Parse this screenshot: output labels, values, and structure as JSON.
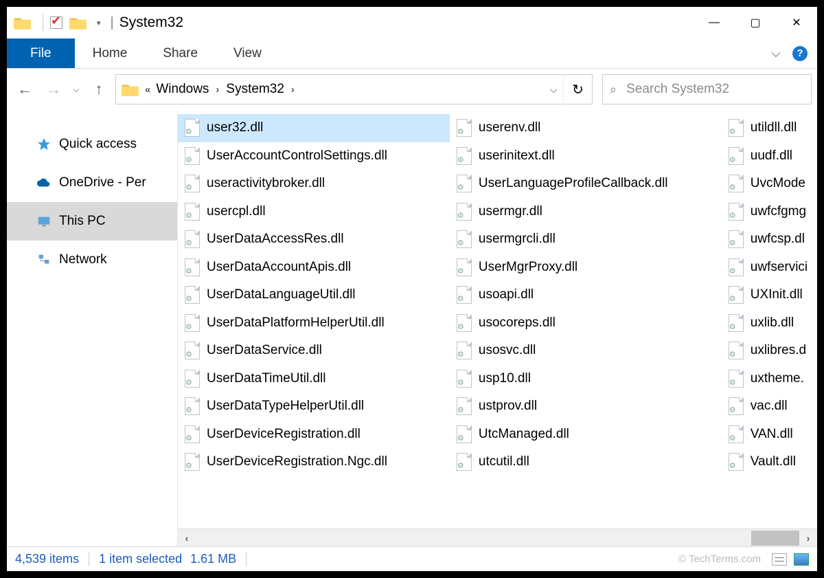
{
  "window": {
    "title": "System32"
  },
  "ribbon": {
    "file": "File",
    "tabs": [
      "Home",
      "Share",
      "View"
    ]
  },
  "nav": {
    "breadcrumbs": [
      "Windows",
      "System32"
    ]
  },
  "search": {
    "placeholder": "Search System32"
  },
  "sidebar": {
    "items": [
      {
        "label": "Quick access",
        "icon": "star",
        "selected": false
      },
      {
        "label": "OneDrive - Per",
        "icon": "cloud",
        "selected": false
      },
      {
        "label": "This PC",
        "icon": "pc",
        "selected": true
      },
      {
        "label": "Network",
        "icon": "network",
        "selected": false
      }
    ]
  },
  "files": {
    "columns": [
      [
        {
          "name": "user32.dll",
          "selected": true
        },
        {
          "name": "UserAccountControlSettings.dll"
        },
        {
          "name": "useractivitybroker.dll"
        },
        {
          "name": "usercpl.dll"
        },
        {
          "name": "UserDataAccessRes.dll"
        },
        {
          "name": "UserDataAccountApis.dll"
        },
        {
          "name": "UserDataLanguageUtil.dll"
        },
        {
          "name": "UserDataPlatformHelperUtil.dll"
        },
        {
          "name": "UserDataService.dll"
        },
        {
          "name": "UserDataTimeUtil.dll"
        },
        {
          "name": "UserDataTypeHelperUtil.dll"
        },
        {
          "name": "UserDeviceRegistration.dll"
        },
        {
          "name": "UserDeviceRegistration.Ngc.dll"
        }
      ],
      [
        {
          "name": "userenv.dll"
        },
        {
          "name": "userinitext.dll"
        },
        {
          "name": "UserLanguageProfileCallback.dll"
        },
        {
          "name": "usermgr.dll"
        },
        {
          "name": "usermgrcli.dll"
        },
        {
          "name": "UserMgrProxy.dll"
        },
        {
          "name": "usoapi.dll"
        },
        {
          "name": "usocoreps.dll"
        },
        {
          "name": "usosvc.dll"
        },
        {
          "name": "usp10.dll"
        },
        {
          "name": "ustprov.dll"
        },
        {
          "name": "UtcManaged.dll"
        },
        {
          "name": "utcutil.dll"
        }
      ],
      [
        {
          "name": "utildll.dll"
        },
        {
          "name": "uudf.dll"
        },
        {
          "name": "UvcMode"
        },
        {
          "name": "uwfcfgmg"
        },
        {
          "name": "uwfcsp.dl"
        },
        {
          "name": "uwfservici"
        },
        {
          "name": "UXInit.dll"
        },
        {
          "name": "uxlib.dll"
        },
        {
          "name": "uxlibres.d"
        },
        {
          "name": "uxtheme."
        },
        {
          "name": "vac.dll"
        },
        {
          "name": "VAN.dll"
        },
        {
          "name": "Vault.dll"
        }
      ]
    ]
  },
  "status": {
    "total_items": "4,539 items",
    "selected": "1 item selected",
    "size": "1.61 MB",
    "watermark": "© TechTerms.com"
  }
}
